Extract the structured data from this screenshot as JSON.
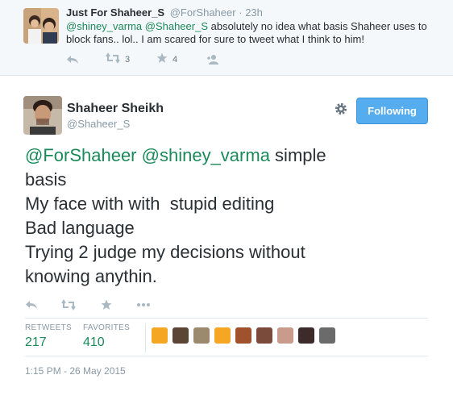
{
  "reply_tweet": {
    "name": "Just For Shaheer_S",
    "handle": "@ForShaheer",
    "time": "23h",
    "mention_1": "@shiney_varma",
    "mention_2": "@Shaheer_S",
    "text_after": " absolutely no idea what basis Shaheer uses to block fans.. lol.. I am scared for sure to tweet what I think to him!",
    "retweet_count": "3",
    "favorite_count": "4"
  },
  "main_tweet": {
    "name": "Shaheer Sheikh",
    "handle": "@Shaheer_S",
    "follow_button_label": "Following",
    "mention_1": "@ForShaheer",
    "mention_2": "@shiney_varma",
    "line_1_after": " simple",
    "line_2": "basis",
    "line_3": "My face with with  stupid editing",
    "line_4": "Bad language",
    "line_5": "Trying 2 judge my decisions without",
    "line_6": "knowing anythin.",
    "retweets_label": "RETWEETS",
    "retweets_count": "217",
    "favorites_label": "FAVORITES",
    "favorites_count": "410",
    "timestamp": "1:15 PM - 26 May 2015"
  },
  "favoriter_avatars": [
    {
      "color": "#f5a623",
      "name": "favoriter-avatar-1"
    },
    {
      "color": "#5b4636",
      "name": "favoriter-avatar-2"
    },
    {
      "color": "#9c8a6e",
      "name": "favoriter-avatar-3"
    },
    {
      "color": "#f5a623",
      "name": "favoriter-avatar-4"
    },
    {
      "color": "#a0522d",
      "name": "favoriter-avatar-5"
    },
    {
      "color": "#7a4b3a",
      "name": "favoriter-avatar-6"
    },
    {
      "color": "#c89b8c",
      "name": "favoriter-avatar-7"
    },
    {
      "color": "#3d2b2b",
      "name": "favoriter-avatar-8"
    },
    {
      "color": "#6b6b6b",
      "name": "favoriter-avatar-9"
    }
  ],
  "colors": {
    "link": "#1b8a5a",
    "follow_button": "#55acee",
    "muted": "#8899a6"
  },
  "icons": [
    "reply-icon",
    "retweet-icon",
    "favorite-icon",
    "follow-icon",
    "more-icon",
    "gear-icon"
  ]
}
